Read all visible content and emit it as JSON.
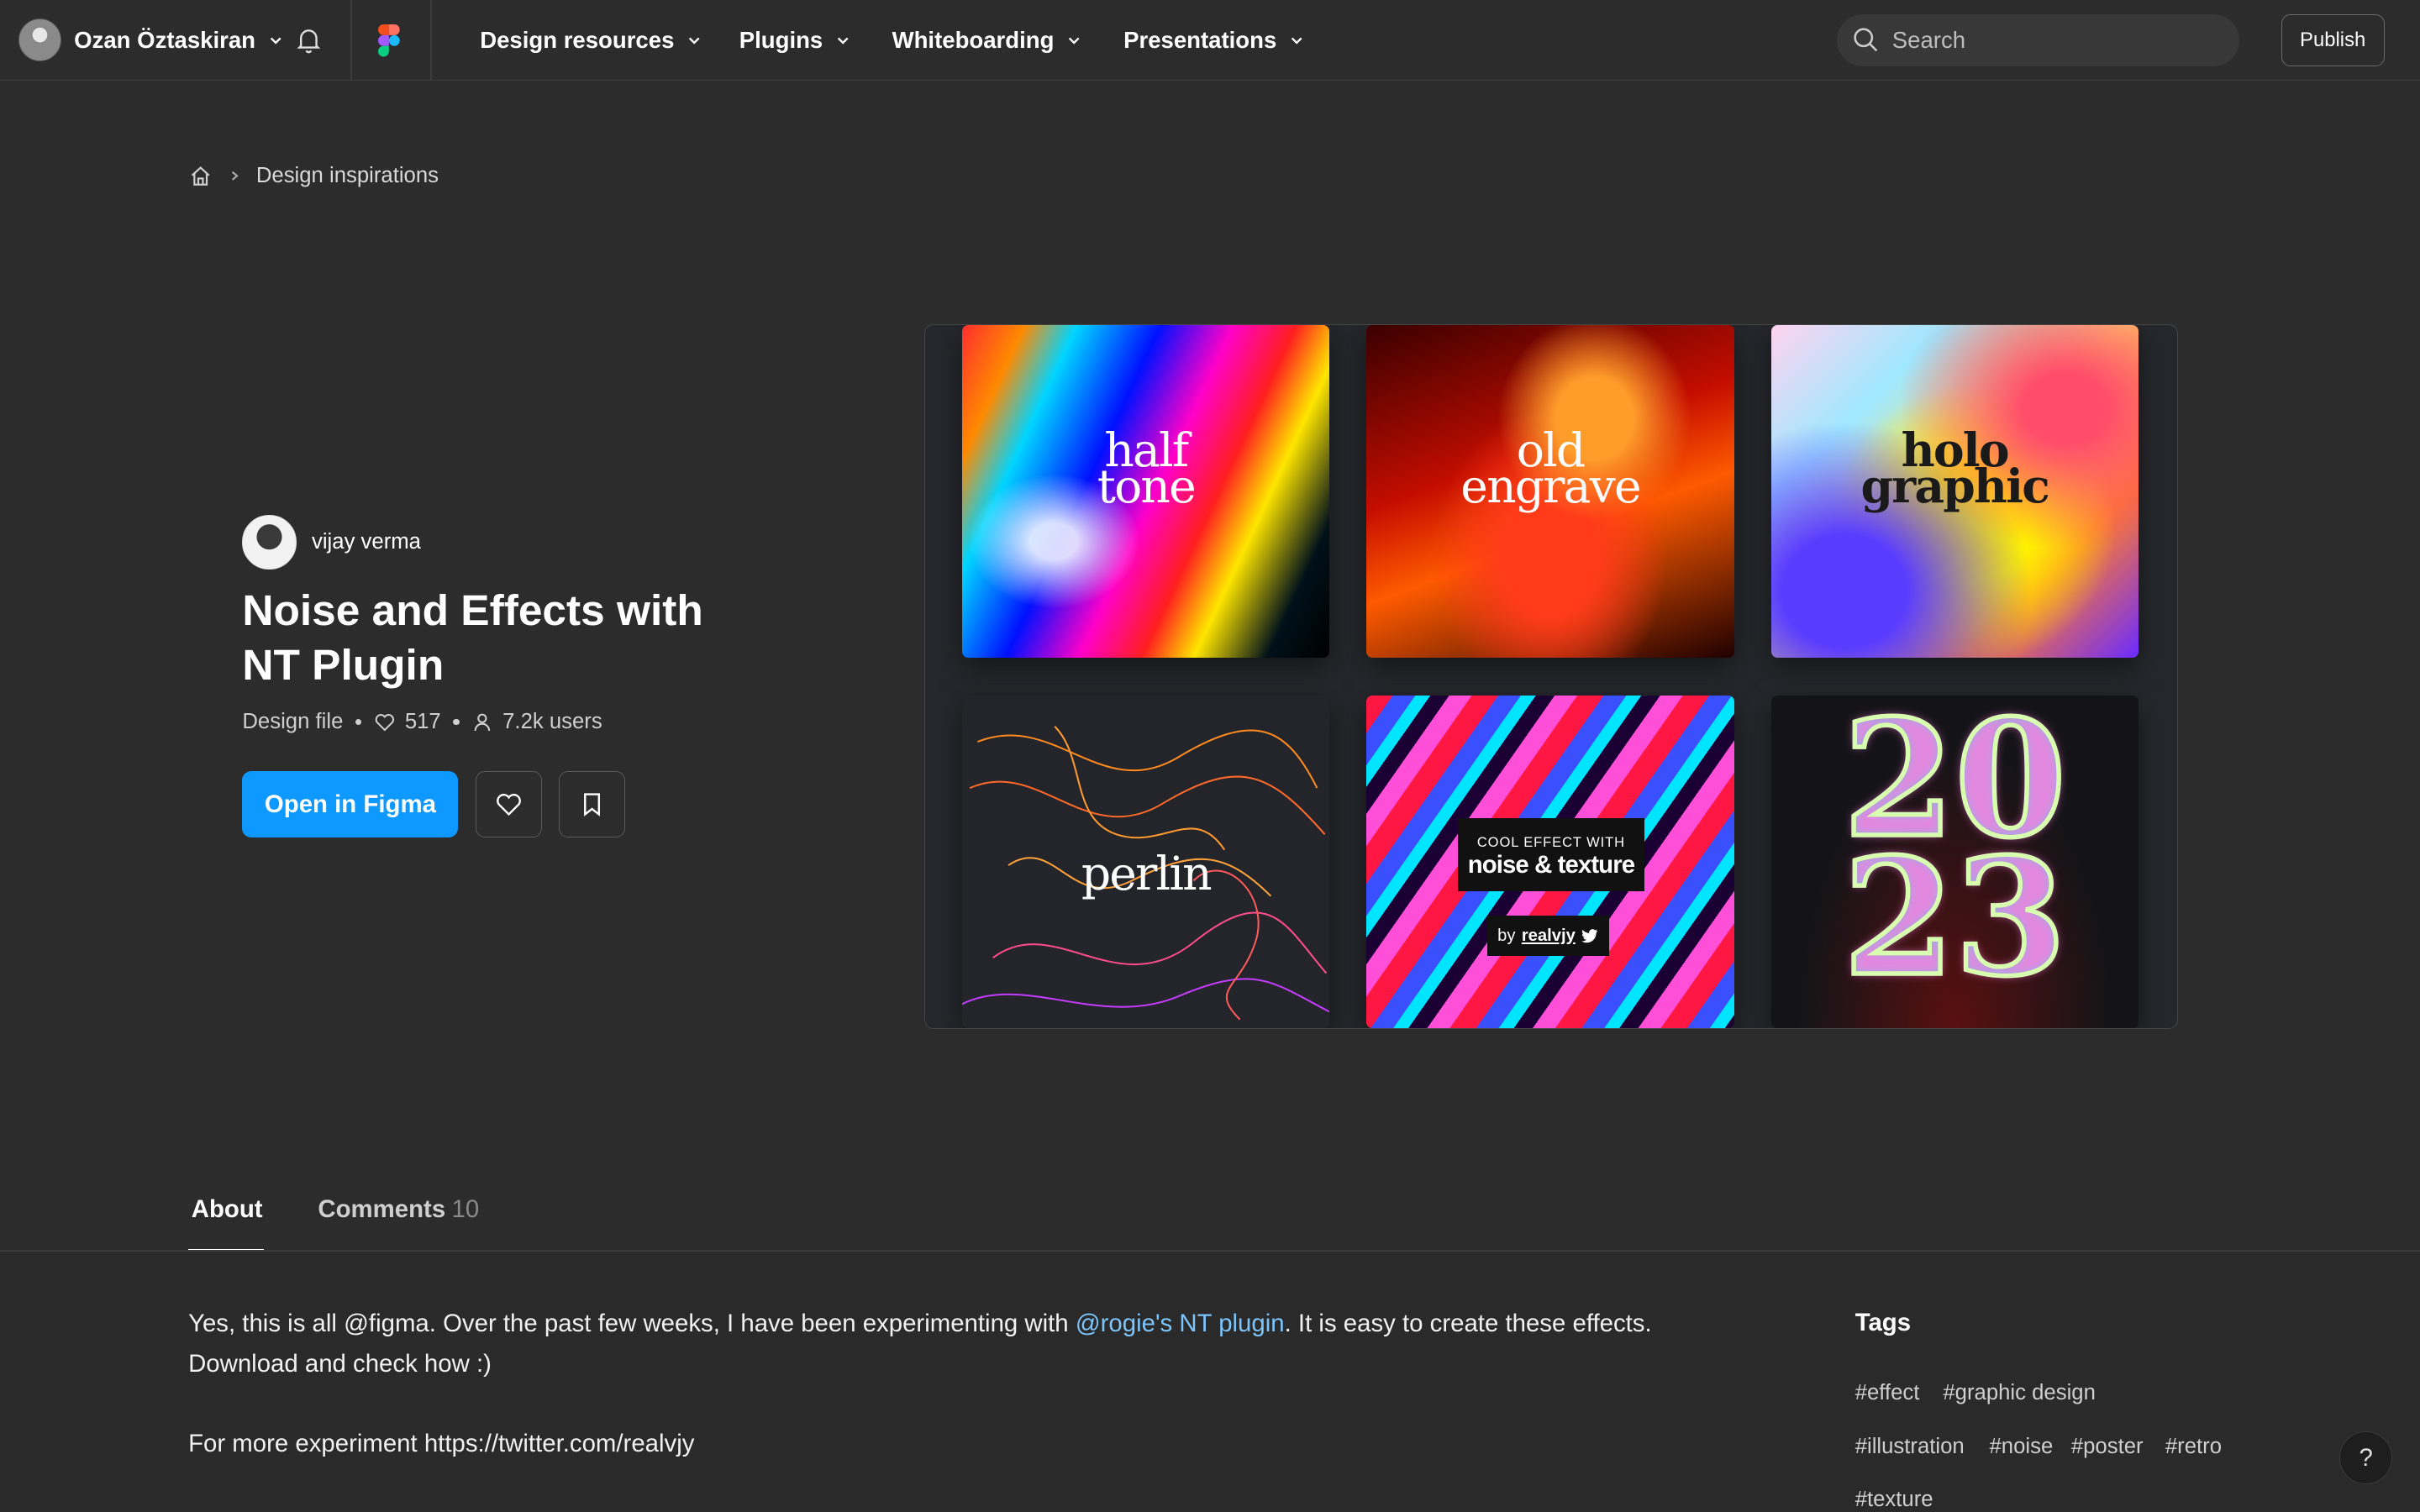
{
  "header": {
    "user_name": "Ozan Öztaskiran",
    "nav": [
      "Design resources",
      "Plugins",
      "Whiteboarding",
      "Presentations"
    ],
    "search_placeholder": "Search",
    "publish_label": "Publish"
  },
  "breadcrumb": {
    "current": "Design inspirations"
  },
  "file": {
    "author": "vijay verma",
    "title": "Noise and Effects with NT Plugin",
    "type": "Design file",
    "likes": "517",
    "users": "7.2k users",
    "open_label": "Open in Figma"
  },
  "preview": {
    "tiles": [
      {
        "line1": "half",
        "line2": "tone"
      },
      {
        "line1": "old",
        "line2": "engrave"
      },
      {
        "line1": "holo",
        "line2": "graphic"
      },
      {
        "line1": "perlin"
      },
      {
        "small": "COOL EFFECT WITH",
        "big": "noise & texture",
        "by": "by",
        "handle": "realvjy"
      },
      {
        "line1": "20",
        "line2": "23"
      }
    ]
  },
  "tabs": {
    "about": "About",
    "comments": "Comments",
    "comments_count": "10"
  },
  "about": {
    "text_before": "Yes, this is all @figma. Over the past few weeks, I have been experimenting with ",
    "link": "@rogie's NT plugin",
    "text_after": ". It is easy to create these effects. Download and check how :)",
    "more": "For more experiment https://twitter.com/realvjy"
  },
  "tags": {
    "title": "Tags",
    "items": [
      "#effect",
      "#graphic design",
      "#illustration",
      "#noise",
      "#poster",
      "#retro",
      "#texture"
    ]
  },
  "help_label": "?"
}
